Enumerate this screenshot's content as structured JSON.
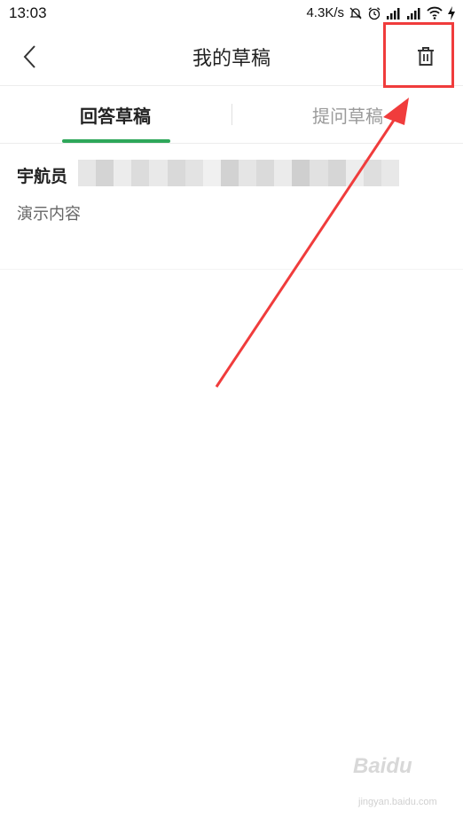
{
  "status_bar": {
    "time": "13:03",
    "speed": "4.3K/s",
    "icons": [
      "mute-bell-icon",
      "alarm-icon",
      "signal-icon",
      "signal-icon",
      "wifi-icon",
      "charging-icon"
    ]
  },
  "header": {
    "title": "我的草稿",
    "back_icon": "back-arrow-icon",
    "delete_icon": "trash-icon"
  },
  "tabs": [
    {
      "label": "回答草稿",
      "active": true
    },
    {
      "label": "提问草稿",
      "active": false
    }
  ],
  "drafts": [
    {
      "title": "宇航员",
      "content": "演示内容"
    }
  ],
  "watermark": {
    "logo": "Baidu",
    "sub": "jingyan.baidu.com"
  },
  "colors": {
    "accent_green": "#2ea75a",
    "annotation_red": "#f03c3c"
  }
}
